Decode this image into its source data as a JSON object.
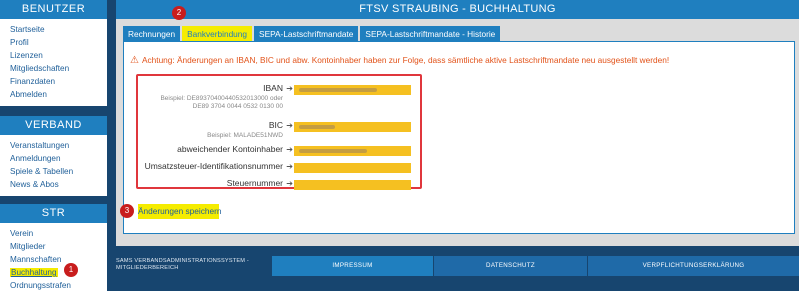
{
  "sidebar": {
    "benutzer": {
      "title": "BENUTZER",
      "items": [
        "Startseite",
        "Profil",
        "Lizenzen",
        "Mitgliedschaften",
        "Finanzdaten",
        "Abmelden"
      ]
    },
    "verband": {
      "title": "VERBAND",
      "items": [
        "Veranstaltungen",
        "Anmeldungen",
        "Spiele & Tabellen",
        "News & Abos"
      ]
    },
    "str": {
      "title": "STR",
      "items": [
        "Verein",
        "Mitglieder",
        "Mannschaften",
        "Buchhaltung",
        "Ordnungsstrafen"
      ]
    }
  },
  "main": {
    "title": "FTSV STRAUBING - BUCHHALTUNG",
    "tabs": [
      "Rechnungen",
      "Bankverbindung",
      "SEPA-Lastschriftmandate",
      "SEPA-Lastschriftmandate - Historie"
    ],
    "active_tab": "Bankverbindung",
    "warning": "Achtung: Änderungen an IBAN, BIC und abw. Kontoinhaber haben zur Folge, dass sämtliche aktive Lastschriftmandate neu ausgestellt werden!",
    "fields": {
      "iban": {
        "label": "IBAN",
        "hint1": "Beispiel: DE89370400440532013000 oder",
        "hint2": "DE89 3704 0044 0532 0130 00"
      },
      "bic": {
        "label": "BIC",
        "hint1": "Beispiel: MALADE51NWD"
      },
      "owner": {
        "label": "abweichender Kontoinhaber"
      },
      "vat": {
        "label": "Umsatzsteuer-Identifikationsnummer"
      },
      "tax": {
        "label": "Steuernummer"
      }
    },
    "save_label": "Änderungen speichern"
  },
  "badges": {
    "b1": "1",
    "b2": "2",
    "b3": "3"
  },
  "footer": {
    "system_line1": "SAMS VERBANDSADMINISTRATIONSSYSTEM -",
    "system_line2": "MITGLIEDERBEREICH",
    "links": [
      "IMPRESSUM",
      "DATENSCHUTZ",
      "VERPFLICHTUNGSERKLÄRUNG"
    ]
  },
  "colors": {
    "accent": "#1f7fbf",
    "highlight": "#f5ec00",
    "field": "#f5c021",
    "warning": "#e2531a",
    "annotation": "#c81d1d"
  }
}
